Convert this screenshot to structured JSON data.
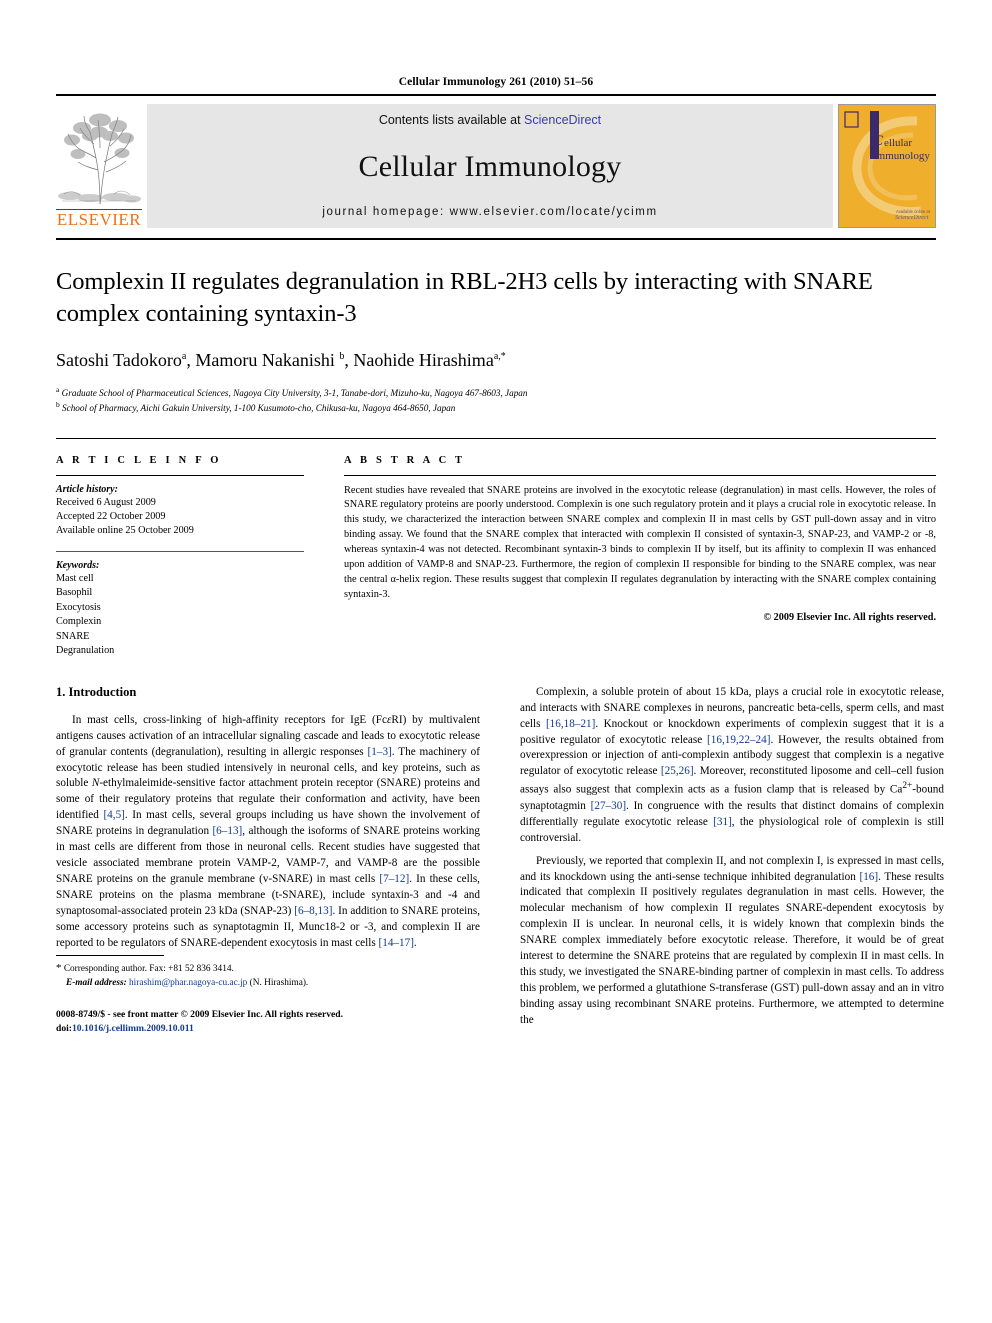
{
  "running_head": "Cellular Immunology 261 (2010) 51–56",
  "masthead": {
    "publisher_wordmark": "ELSEVIER",
    "contents_prefix": "Contents lists available at ",
    "contents_link": "ScienceDirect",
    "journal_name": "Cellular Immunology",
    "homepage": "journal homepage: www.elsevier.com/locate/ycimm",
    "cover_title_line1": "ellular",
    "cover_title_line2": "Immunology",
    "colors": {
      "link_blue": "#3a3ab0",
      "elsevier_orange": "#E9711C",
      "cover_amber": "#EFAF2C",
      "cover_purple": "#3b2a6b",
      "citation_blue": "#123a8f",
      "banner_gray": "#e6e6e6"
    }
  },
  "article": {
    "title": "Complexin II regulates degranulation in RBL-2H3 cells by interacting with SNARE complex containing syntaxin-3",
    "authors": "Satoshi Tadokoro, Mamoru Nakanishi, Naohide Hirashima",
    "author_list": [
      {
        "name": "Satoshi Tadokoro",
        "sup": "a"
      },
      {
        "name": "Mamoru Nakanishi",
        "sup": "b"
      },
      {
        "name": "Naohide Hirashima",
        "sup": "a,*"
      }
    ],
    "affiliations": [
      {
        "marker": "a",
        "text": "Graduate School of Pharmaceutical Sciences, Nagoya City University, 3-1, Tanabe-dori, Mizuho-ku, Nagoya 467-8603, Japan"
      },
      {
        "marker": "b",
        "text": "School of Pharmacy, Aichi Gakuin University, 1-100 Kusumoto-cho, Chikusa-ku, Nagoya 464-8650, Japan"
      }
    ]
  },
  "article_info": {
    "heading": "A R T I C L E    I N F O",
    "history_label": "Article history:",
    "history": [
      "Received 6 August 2009",
      "Accepted 22 October 2009",
      "Available online 25 October 2009"
    ],
    "keywords_label": "Keywords:",
    "keywords": [
      "Mast cell",
      "Basophil",
      "Exocytosis",
      "Complexin",
      "SNARE",
      "Degranulation"
    ]
  },
  "abstract": {
    "heading": "A B S T R A C T",
    "text": "Recent studies have revealed that SNARE proteins are involved in the exocytotic release (degranulation) in mast cells. However, the roles of SNARE regulatory proteins are poorly understood. Complexin is one such regulatory protein and it plays a crucial role in exocytotic release. In this study, we characterized the interaction between SNARE complex and complexin II in mast cells by GST pull-down assay and in vitro binding assay. We found that the SNARE complex that interacted with complexin II consisted of syntaxin-3, SNAP-23, and VAMP-2 or -8, whereas syntaxin-4 was not detected. Recombinant syntaxin-3 binds to complexin II by itself, but its affinity to complexin II was enhanced upon addition of VAMP-8 and SNAP-23. Furthermore, the region of complexin II responsible for binding to the SNARE complex, was near the central α-helix region. These results suggest that complexin II regulates degranulation by interacting with the SNARE complex containing syntaxin-3.",
    "copyright": "© 2009 Elsevier Inc. All rights reserved."
  },
  "introduction": {
    "heading": "1. Introduction",
    "left_paragraphs": [
      "In mast cells, cross-linking of high-affinity receptors for IgE (FcεRI) by multivalent antigens causes activation of an intracellular signaling cascade and leads to exocytotic release of granular contents (degranulation), resulting in allergic responses [1–3]. The machinery of exocytotic release has been studied intensively in neuronal cells, and key proteins, such as soluble N-ethylmaleimide-sensitive factor attachment protein receptor (SNARE) proteins and some of their regulatory proteins that regulate their conformation and activity, have been identified [4,5]. In mast cells, several groups including us have shown the involvement of SNARE proteins in degranulation [6–13], although the isoforms of SNARE proteins working in mast cells are different from those in neuronal cells. Recent studies have suggested that vesicle associated membrane protein VAMP-2, VAMP-7, and VAMP-8 are the possible SNARE proteins on the granule membrane (v-SNARE) in mast cells [7–12]. In these cells, SNARE proteins on the plasma membrane (t-SNARE), include syntaxin-3 and -4 and synaptosomal-associated protein 23 kDa (SNAP-23) [6–8,13]. In addition to SNARE proteins, some accessory proteins such as synaptotagmin II, Munc18-2 or -3, and complexin II are reported to be regulators of SNARE-dependent exocytosis in mast cells [14–17]."
    ],
    "right_paragraphs": [
      "Complexin, a soluble protein of about 15 kDa, plays a crucial role in exocytotic release, and interacts with SNARE complexes in neurons, pancreatic beta-cells, sperm cells, and mast cells [16,18–21]. Knockout or knockdown experiments of complexin suggest that it is a positive regulator of exocytotic release [16,19,22–24]. However, the results obtained from overexpression or injection of anti-complexin antibody suggest that complexin is a negative regulator of exocytotic release [25,26]. Moreover, reconstituted liposome and cell–cell fusion assays also suggest that complexin acts as a fusion clamp that is released by Ca2+-bound synaptotagmin [27–30]. In congruence with the results that distinct domains of complexin differentially regulate exocytotic release [31], the physiological role of complexin is still controversial.",
      "Previously, we reported that complexin II, and not complexin I, is expressed in mast cells, and its knockdown using the anti-sense technique inhibited degranulation [16]. These results indicated that complexin II positively regulates degranulation in mast cells. However, the molecular mechanism of how complexin II regulates SNARE-dependent exocytosis by complexin II is unclear. In neuronal cells, it is widely known that complexin binds the SNARE complex immediately before exocytotic release. Therefore, it would be of great interest to determine the SNARE proteins that are regulated by complexin II in mast cells. In this study, we investigated the SNARE-binding partner of complexin in mast cells. To address this problem, we performed a glutathione S-transferase (GST) pull-down assay and an in vitro binding assay using recombinant SNARE proteins. Furthermore, we attempted to determine the"
    ]
  },
  "footnote": {
    "corresponding": "Corresponding author. Fax: +81 52 836 3414.",
    "email_label": "E-mail address:",
    "email": "hirashim@phar.nagoya-cu.ac.jp",
    "email_suffix": "(N. Hirashima).",
    "issn_line": "0008-8749/$ - see front matter © 2009 Elsevier Inc. All rights reserved.",
    "doi_prefix": "doi:",
    "doi": "10.1016/j.cellimm.2009.10.011"
  }
}
